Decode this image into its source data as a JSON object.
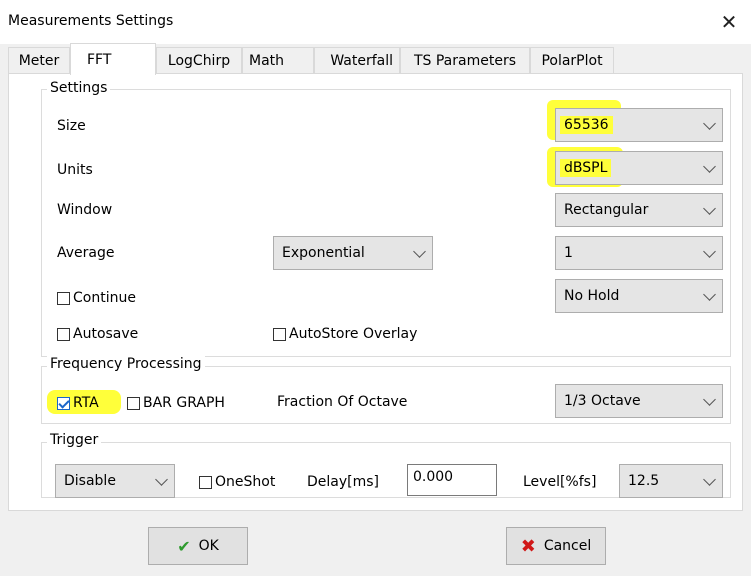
{
  "window": {
    "title": "Measurements Settings"
  },
  "tabs": [
    {
      "label": "Meter"
    },
    {
      "label": "FFT"
    },
    {
      "label": "LogChirp"
    },
    {
      "label": "Math"
    },
    {
      "label": "Waterfall"
    },
    {
      "label": "TS Parameters"
    },
    {
      "label": "PolarPlot"
    }
  ],
  "active_tab": "FFT",
  "settings": {
    "legend": "Settings",
    "size_label": "Size",
    "size_value": "65536",
    "units_label": "Units",
    "units_value": "dBSPL",
    "window_label": "Window",
    "window_value": "Rectangular",
    "average_label": "Average",
    "average_type_value": "Exponential",
    "average_count_value": "1",
    "continue_label": "Continue",
    "continue_checked": false,
    "hold_value": "No Hold",
    "autosave_label": "Autosave",
    "autosave_checked": false,
    "autostore_label": "AutoStore Overlay",
    "autostore_checked": false
  },
  "frequency": {
    "legend": "Frequency Processing",
    "rta_label": "RTA",
    "rta_checked": true,
    "bar_label": "BAR GRAPH",
    "bar_checked": false,
    "fraction_label": "Fraction Of Octave",
    "fraction_value": "1/3 Octave"
  },
  "trigger": {
    "legend": "Trigger",
    "mode_value": "Disable",
    "oneshot_label": "OneShot",
    "oneshot_checked": false,
    "delay_label": "Delay[ms]",
    "delay_value": "0.000",
    "level_label": "Level[%fs]",
    "level_value": "12.5"
  },
  "buttons": {
    "ok_label": "OK",
    "cancel_label": "Cancel"
  },
  "colors": {
    "highlight": "#ffff3a",
    "ok_icon": "#2e9b2e",
    "cancel_icon": "#d01818"
  }
}
